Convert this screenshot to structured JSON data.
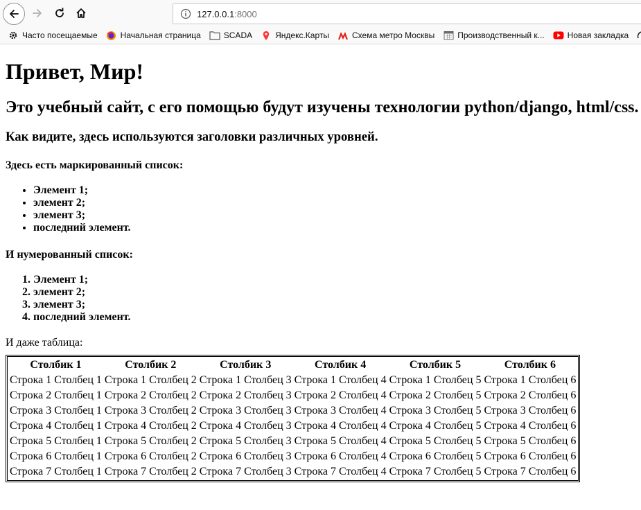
{
  "browser": {
    "url_host": "127.0.0.1",
    "url_port": ":8000",
    "bookmarks": [
      {
        "label": "Часто посещаемые",
        "icon": "gear-icon"
      },
      {
        "label": "Начальная страница",
        "icon": "firefox-icon"
      },
      {
        "label": "SCADA",
        "icon": "folder-icon"
      },
      {
        "label": "Яндекс.Карты",
        "icon": "map-pin-icon"
      },
      {
        "label": "Схема метро Москвы",
        "icon": "metro-icon"
      },
      {
        "label": "Производственный к...",
        "icon": "calendar-icon"
      },
      {
        "label": "Новая закладка",
        "icon": "youtube-icon"
      }
    ]
  },
  "page": {
    "h1": "Привет, Мир!",
    "h2": "Это учебный сайт, с его помощью будут изучены технологии python/django, html/css.",
    "h3": "Как видите, здесь используются заголовки различных уровней.",
    "ul_heading": "Здесь есть маркированный список:",
    "ul_items": [
      "Элемент 1;",
      "элемент 2;",
      "элемент 3;",
      "последний элемент."
    ],
    "ol_heading": "И нумерованный список:",
    "ol_items": [
      "Элемент 1;",
      "элемент 2;",
      "элемент 3;",
      "последний элемент."
    ],
    "table_intro": "И даже таблица:",
    "table": {
      "headers": [
        "Столбик 1",
        "Столбик 2",
        "Столбик 3",
        "Столбик 4",
        "Столбик 5",
        "Столбик 6"
      ],
      "rows": [
        [
          "Строка 1 Столбец 1",
          "Строка 1 Столбец 2",
          "Строка 1 Столбец 3",
          "Строка 1 Столбец 4",
          "Строка 1 Столбец 5",
          "Строка 1 Столбец 6"
        ],
        [
          "Строка 2 Столбец 1",
          "Строка 2 Столбец 2",
          "Строка 2 Столбец 3",
          "Строка 2 Столбец 4",
          "Строка 2 Столбец 5",
          "Строка 2 Столбец 6"
        ],
        [
          "Строка 3 Столбец 1",
          "Строка 3 Столбец 2",
          "Строка 3 Столбец 3",
          "Строка 3 Столбец 4",
          "Строка 3 Столбец 5",
          "Строка 3 Столбец 6"
        ],
        [
          "Строка 4 Столбец 1",
          "Строка 4 Столбец 2",
          "Строка 4 Столбец 3",
          "Строка 4 Столбец 4",
          "Строка 4 Столбец 5",
          "Строка 4 Столбец 6"
        ],
        [
          "Строка 5 Столбец 1",
          "Строка 5 Столбец 2",
          "Строка 5 Столбец 3",
          "Строка 5 Столбец 4",
          "Строка 5 Столбец 5",
          "Строка 5 Столбец 6"
        ],
        [
          "Строка 6 Столбец 1",
          "Строка 6 Столбец 2",
          "Строка 6 Столбец 3",
          "Строка 6 Столбец 4",
          "Строка 6 Столбец 5",
          "Строка 6 Столбец 6"
        ],
        [
          "Строка 7 Столбец 1",
          "Строка 7 Столбец 2",
          "Строка 7 Столбец 3",
          "Строка 7 Столбец 4",
          "Строка 7 Столбец 5",
          "Строка 7 Столбец 6"
        ]
      ]
    }
  }
}
